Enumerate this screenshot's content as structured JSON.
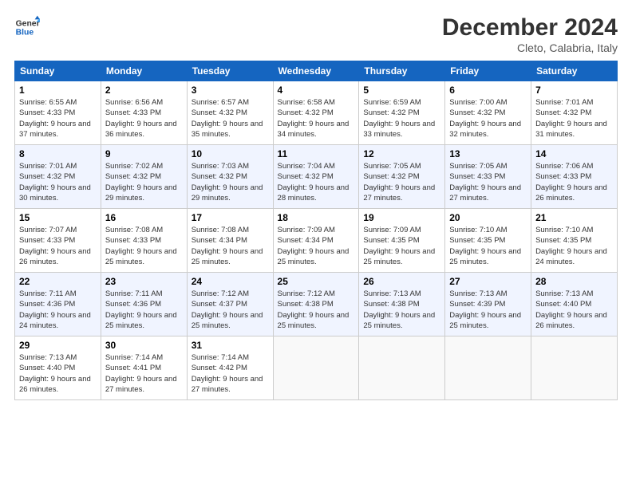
{
  "header": {
    "logo_general": "General",
    "logo_blue": "Blue",
    "month": "December 2024",
    "location": "Cleto, Calabria, Italy"
  },
  "weekdays": [
    "Sunday",
    "Monday",
    "Tuesday",
    "Wednesday",
    "Thursday",
    "Friday",
    "Saturday"
  ],
  "weeks": [
    [
      {
        "day": "1",
        "sunrise": "Sunrise: 6:55 AM",
        "sunset": "Sunset: 4:33 PM",
        "daylight": "Daylight: 9 hours and 37 minutes."
      },
      {
        "day": "2",
        "sunrise": "Sunrise: 6:56 AM",
        "sunset": "Sunset: 4:33 PM",
        "daylight": "Daylight: 9 hours and 36 minutes."
      },
      {
        "day": "3",
        "sunrise": "Sunrise: 6:57 AM",
        "sunset": "Sunset: 4:32 PM",
        "daylight": "Daylight: 9 hours and 35 minutes."
      },
      {
        "day": "4",
        "sunrise": "Sunrise: 6:58 AM",
        "sunset": "Sunset: 4:32 PM",
        "daylight": "Daylight: 9 hours and 34 minutes."
      },
      {
        "day": "5",
        "sunrise": "Sunrise: 6:59 AM",
        "sunset": "Sunset: 4:32 PM",
        "daylight": "Daylight: 9 hours and 33 minutes."
      },
      {
        "day": "6",
        "sunrise": "Sunrise: 7:00 AM",
        "sunset": "Sunset: 4:32 PM",
        "daylight": "Daylight: 9 hours and 32 minutes."
      },
      {
        "day": "7",
        "sunrise": "Sunrise: 7:01 AM",
        "sunset": "Sunset: 4:32 PM",
        "daylight": "Daylight: 9 hours and 31 minutes."
      }
    ],
    [
      {
        "day": "8",
        "sunrise": "Sunrise: 7:01 AM",
        "sunset": "Sunset: 4:32 PM",
        "daylight": "Daylight: 9 hours and 30 minutes."
      },
      {
        "day": "9",
        "sunrise": "Sunrise: 7:02 AM",
        "sunset": "Sunset: 4:32 PM",
        "daylight": "Daylight: 9 hours and 29 minutes."
      },
      {
        "day": "10",
        "sunrise": "Sunrise: 7:03 AM",
        "sunset": "Sunset: 4:32 PM",
        "daylight": "Daylight: 9 hours and 29 minutes."
      },
      {
        "day": "11",
        "sunrise": "Sunrise: 7:04 AM",
        "sunset": "Sunset: 4:32 PM",
        "daylight": "Daylight: 9 hours and 28 minutes."
      },
      {
        "day": "12",
        "sunrise": "Sunrise: 7:05 AM",
        "sunset": "Sunset: 4:32 PM",
        "daylight": "Daylight: 9 hours and 27 minutes."
      },
      {
        "day": "13",
        "sunrise": "Sunrise: 7:05 AM",
        "sunset": "Sunset: 4:33 PM",
        "daylight": "Daylight: 9 hours and 27 minutes."
      },
      {
        "day": "14",
        "sunrise": "Sunrise: 7:06 AM",
        "sunset": "Sunset: 4:33 PM",
        "daylight": "Daylight: 9 hours and 26 minutes."
      }
    ],
    [
      {
        "day": "15",
        "sunrise": "Sunrise: 7:07 AM",
        "sunset": "Sunset: 4:33 PM",
        "daylight": "Daylight: 9 hours and 26 minutes."
      },
      {
        "day": "16",
        "sunrise": "Sunrise: 7:08 AM",
        "sunset": "Sunset: 4:33 PM",
        "daylight": "Daylight: 9 hours and 25 minutes."
      },
      {
        "day": "17",
        "sunrise": "Sunrise: 7:08 AM",
        "sunset": "Sunset: 4:34 PM",
        "daylight": "Daylight: 9 hours and 25 minutes."
      },
      {
        "day": "18",
        "sunrise": "Sunrise: 7:09 AM",
        "sunset": "Sunset: 4:34 PM",
        "daylight": "Daylight: 9 hours and 25 minutes."
      },
      {
        "day": "19",
        "sunrise": "Sunrise: 7:09 AM",
        "sunset": "Sunset: 4:35 PM",
        "daylight": "Daylight: 9 hours and 25 minutes."
      },
      {
        "day": "20",
        "sunrise": "Sunrise: 7:10 AM",
        "sunset": "Sunset: 4:35 PM",
        "daylight": "Daylight: 9 hours and 25 minutes."
      },
      {
        "day": "21",
        "sunrise": "Sunrise: 7:10 AM",
        "sunset": "Sunset: 4:35 PM",
        "daylight": "Daylight: 9 hours and 24 minutes."
      }
    ],
    [
      {
        "day": "22",
        "sunrise": "Sunrise: 7:11 AM",
        "sunset": "Sunset: 4:36 PM",
        "daylight": "Daylight: 9 hours and 24 minutes."
      },
      {
        "day": "23",
        "sunrise": "Sunrise: 7:11 AM",
        "sunset": "Sunset: 4:36 PM",
        "daylight": "Daylight: 9 hours and 25 minutes."
      },
      {
        "day": "24",
        "sunrise": "Sunrise: 7:12 AM",
        "sunset": "Sunset: 4:37 PM",
        "daylight": "Daylight: 9 hours and 25 minutes."
      },
      {
        "day": "25",
        "sunrise": "Sunrise: 7:12 AM",
        "sunset": "Sunset: 4:38 PM",
        "daylight": "Daylight: 9 hours and 25 minutes."
      },
      {
        "day": "26",
        "sunrise": "Sunrise: 7:13 AM",
        "sunset": "Sunset: 4:38 PM",
        "daylight": "Daylight: 9 hours and 25 minutes."
      },
      {
        "day": "27",
        "sunrise": "Sunrise: 7:13 AM",
        "sunset": "Sunset: 4:39 PM",
        "daylight": "Daylight: 9 hours and 25 minutes."
      },
      {
        "day": "28",
        "sunrise": "Sunrise: 7:13 AM",
        "sunset": "Sunset: 4:40 PM",
        "daylight": "Daylight: 9 hours and 26 minutes."
      }
    ],
    [
      {
        "day": "29",
        "sunrise": "Sunrise: 7:13 AM",
        "sunset": "Sunset: 4:40 PM",
        "daylight": "Daylight: 9 hours and 26 minutes."
      },
      {
        "day": "30",
        "sunrise": "Sunrise: 7:14 AM",
        "sunset": "Sunset: 4:41 PM",
        "daylight": "Daylight: 9 hours and 27 minutes."
      },
      {
        "day": "31",
        "sunrise": "Sunrise: 7:14 AM",
        "sunset": "Sunset: 4:42 PM",
        "daylight": "Daylight: 9 hours and 27 minutes."
      },
      null,
      null,
      null,
      null
    ]
  ]
}
